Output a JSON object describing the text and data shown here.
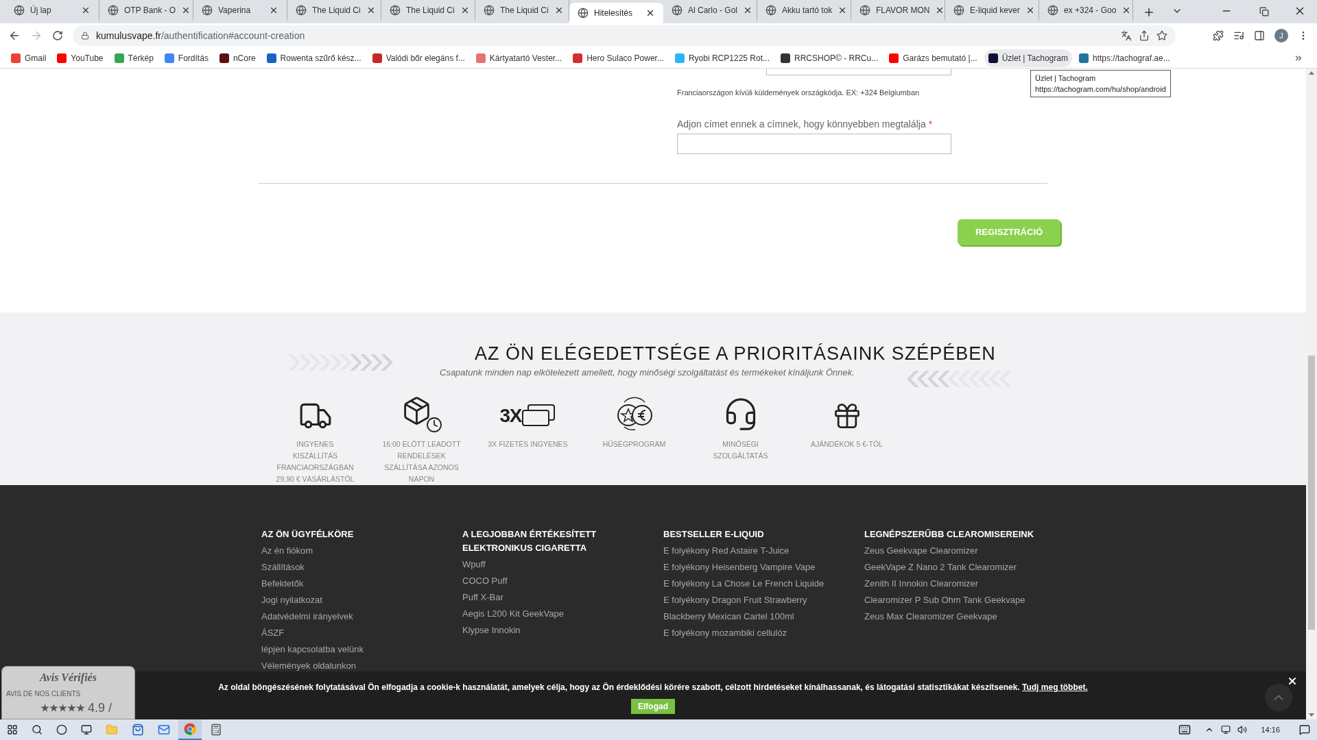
{
  "browser": {
    "tabs": [
      {
        "title": "Új lap",
        "selected": false
      },
      {
        "title": "OTP Bank - O",
        "selected": false
      },
      {
        "title": "Vaperina",
        "selected": false
      },
      {
        "title": "The Liquid Ci",
        "selected": false
      },
      {
        "title": "The Liquid Ci",
        "selected": false
      },
      {
        "title": "The Liquid Ci",
        "selected": false
      },
      {
        "title": "Hitelesítés",
        "selected": true
      },
      {
        "title": "Al Carlo - Gol",
        "selected": false
      },
      {
        "title": "Akku tartó tok",
        "selected": false
      },
      {
        "title": "FLAVOR MON",
        "selected": false
      },
      {
        "title": "E-liquid kever",
        "selected": false
      },
      {
        "title": "ex +324 - Goo",
        "selected": false
      }
    ],
    "forward_enabled": false,
    "url_host": "kumulusvape.fr",
    "url_path": "/authentification#account-creation",
    "profile_initial": "J",
    "bookmarks": [
      {
        "label": "Gmail",
        "hovered": false,
        "color": "#ea4335"
      },
      {
        "label": "YouTube",
        "hovered": false,
        "color": "#ff0000"
      },
      {
        "label": "Térkép",
        "hovered": false,
        "color": "#34a853"
      },
      {
        "label": "Fordítás",
        "hovered": false,
        "color": "#4285f4"
      },
      {
        "label": "nCore",
        "hovered": false,
        "color": "#5a1010"
      },
      {
        "label": "Rowenta szűrő kész...",
        "hovered": false,
        "color": "#1565c0"
      },
      {
        "label": "Valódi bőr elegáns f...",
        "hovered": false,
        "color": "#c62828"
      },
      {
        "label": "Kártyatartó Vester...",
        "hovered": false,
        "color": "#e57373"
      },
      {
        "label": "Hero Sulaco Power...",
        "hovered": false,
        "color": "#d32f2f"
      },
      {
        "label": "Ryobi RCP1225 Rot...",
        "hovered": false,
        "color": "#29b6f6"
      },
      {
        "label": "RRCSHOP© - RRCu...",
        "hovered": false,
        "color": "#333333"
      },
      {
        "label": "Garázs bemutató |...",
        "hovered": false,
        "color": "#ff0000"
      },
      {
        "label": "Üzlet | Tachogram",
        "hovered": true,
        "color": "#111133"
      },
      {
        "label": "https://tachograf.ae...",
        "hovered": false,
        "color": "#21759b"
      }
    ],
    "tooltip": {
      "title": "Üzlet | Tachogram",
      "url": "https://tachogram.com/hu/shop/android"
    }
  },
  "form": {
    "note": "Franciaországon kívüli küldemények országkódja. EX: +324 Belgiumban",
    "address_label": "Adjon címet ennek a címnek, hogy könnyebben megtalálja",
    "required_mark": "*",
    "register_button": "REGISZTRÁCIÓ"
  },
  "satisfaction": {
    "title": "AZ ÖN ELÉGEDETTSÉGE A PRIORITÁSAINK SZÉPÉBEN",
    "subtitle": "Csapatunk minden nap elkötelezett amellett, hogy minőségi szolgáltatást és termékeket kínáljunk Önnek.",
    "features": [
      {
        "kind": "truck",
        "label": "INGYENES KISZÁLLÍTÁS FRANCIAORSZÁGBAN 29,90 € VÁSÁRLÁSTÓL"
      },
      {
        "kind": "box-clock",
        "label": "16:00 ELŐTT LEADOTT RENDELÉSEK SZÁLLÍTÁSA AZONOS NAPON"
      },
      {
        "kind": "cards",
        "icon_text": "3X",
        "label": "3X FIZETÉS INGYENES"
      },
      {
        "kind": "coins",
        "label": "HŰSÉGPROGRAM"
      },
      {
        "kind": "headset",
        "label": "MINŐSÉGI SZOLGÁLTATÁS"
      },
      {
        "kind": "gift",
        "label": "AJÁNDÉKOK 5 €-TÓL"
      }
    ]
  },
  "footer": {
    "columns": [
      {
        "title": "AZ ÖN ÜGYFÉLKÖRE",
        "links": [
          "Az én fiókom",
          "Szállítások",
          "Befektetők",
          "Jogi nyilatkozat",
          "Adatvédelmi irányelvek",
          "ÁSZF",
          "lépjen kapcsolatba velünk",
          "Vélemények oldalunkon"
        ]
      },
      {
        "title": "A LEGJOBBAN ÉRTÉKESÍTETT ELEKTRONIKUS CIGARETTA",
        "links": [
          "Wpuff",
          "COCO Puff",
          "Puff X-Bar",
          "Aegis L200 Kit GeekVape",
          "Klypse Innokin"
        ]
      },
      {
        "title": "BESTSELLER E-LIQUID",
        "links": [
          "E folyékony Red Astaire T-Juice",
          "E folyékony Heisenberg Vampire Vape",
          "E folyékony La Chose Le French Liquide",
          "E folyékony Dragon Fruit Strawberry",
          "Blackberry Mexican Cartel 100ml",
          "E folyékony mozambiki cellulóz"
        ]
      },
      {
        "title": "LEGNÉPSZERŰBB CLEAROMISEREINK",
        "links": [
          "Zeus Geekvape Clearomizer",
          "GeekVape Z Nano 2 Tank Clearomizer",
          "Zenith II Innokin Clearomizer",
          "Clearomizer P Sub Ohm Tank Geekvape",
          "Zeus Max Clearomizer Geekvape"
        ]
      }
    ]
  },
  "cookie": {
    "text": "Az oldal böngészésének folytatásával Ön elfogadja a cookie-k használatát, amelyek célja, hogy az Ön érdeklődési körére szabott, célzott hirdetéseket kínálhassanak, és látogatási statisztikákat készítsenek.",
    "link": "Tudj meg többet.",
    "button": "Elfogad"
  },
  "reviews": {
    "brand": "Avis Vérifiés",
    "caption": "AVIS DE NOS CLIENTS",
    "stars": 5,
    "score": "4.9 /"
  },
  "taskbar": {
    "apps": [
      {
        "kind": "explorer",
        "active": false
      },
      {
        "kind": "store",
        "active": false
      },
      {
        "kind": "mail",
        "active": false
      },
      {
        "kind": "chrome",
        "active": true
      },
      {
        "kind": "calculator",
        "active": false
      }
    ],
    "time": "14:16"
  }
}
